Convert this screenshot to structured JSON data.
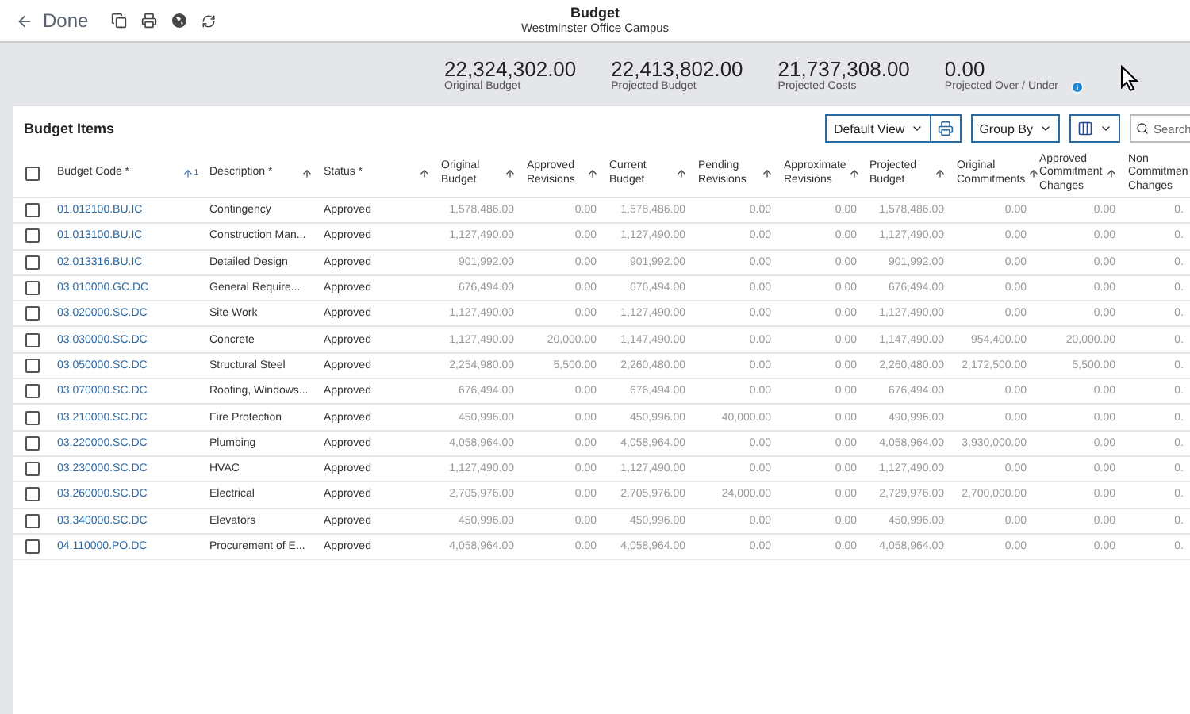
{
  "header": {
    "back_label": "Done",
    "title": "Budget",
    "subtitle": "Westminster Office Campus"
  },
  "summary": [
    {
      "value": "22,324,302.00",
      "label": "Original Budget"
    },
    {
      "value": "22,413,802.00",
      "label": "Projected Budget"
    },
    {
      "value": "21,737,308.00",
      "label": "Projected Costs"
    },
    {
      "value": "0.00",
      "label": "Projected Over / Under",
      "info": true
    }
  ],
  "panel": {
    "title": "Budget Items",
    "view_select": "Default View",
    "group_by": "Group By",
    "search": {
      "placeholder": "Search"
    }
  },
  "table": {
    "select_all": {
      "checked": false
    },
    "columns": [
      {
        "label": "Budget Code *",
        "sort_index": "1"
      },
      {
        "label": "Description *"
      },
      {
        "label": "Status *"
      },
      {
        "label": "Original Budget"
      },
      {
        "label": "Approved Revisions"
      },
      {
        "label": "Current Budget"
      },
      {
        "label": "Pending Revisions"
      },
      {
        "label": "Approximate Revisions"
      },
      {
        "label": "Projected Budget"
      },
      {
        "label": "Original Commitments"
      },
      {
        "label": "Approved Commitment Changes"
      },
      {
        "label": "Non Commitmen Changes"
      }
    ],
    "rows": [
      {
        "checked": false,
        "cells": [
          "01.012100.BU.IC",
          "Contingency",
          "Approved",
          "1,578,486.00",
          "0.00",
          "1,578,486.00",
          "0.00",
          "0.00",
          "1,578,486.00",
          "0.00",
          "0.00",
          "0."
        ]
      },
      {
        "checked": false,
        "cells": [
          "01.013100.BU.IC",
          "Construction Man...",
          "Approved",
          "1,127,490.00",
          "0.00",
          "1,127,490.00",
          "0.00",
          "0.00",
          "1,127,490.00",
          "0.00",
          "0.00",
          "0."
        ]
      },
      {
        "checked": false,
        "cells": [
          "02.013316.BU.IC",
          "Detailed Design",
          "Approved",
          "901,992.00",
          "0.00",
          "901,992.00",
          "0.00",
          "0.00",
          "901,992.00",
          "0.00",
          "0.00",
          "0."
        ]
      },
      {
        "checked": false,
        "cells": [
          "03.010000.GC.DC",
          "General Require...",
          "Approved",
          "676,494.00",
          "0.00",
          "676,494.00",
          "0.00",
          "0.00",
          "676,494.00",
          "0.00",
          "0.00",
          "0."
        ]
      },
      {
        "checked": false,
        "cells": [
          "03.020000.SC.DC",
          "Site Work",
          "Approved",
          "1,127,490.00",
          "0.00",
          "1,127,490.00",
          "0.00",
          "0.00",
          "1,127,490.00",
          "0.00",
          "0.00",
          "0."
        ]
      },
      {
        "checked": false,
        "cells": [
          "03.030000.SC.DC",
          "Concrete",
          "Approved",
          "1,127,490.00",
          "20,000.00",
          "1,147,490.00",
          "0.00",
          "0.00",
          "1,147,490.00",
          "954,400.00",
          "20,000.00",
          "0."
        ]
      },
      {
        "checked": false,
        "cells": [
          "03.050000.SC.DC",
          "Structural Steel",
          "Approved",
          "2,254,980.00",
          "5,500.00",
          "2,260,480.00",
          "0.00",
          "0.00",
          "2,260,480.00",
          "2,172,500.00",
          "5,500.00",
          "0."
        ]
      },
      {
        "checked": false,
        "cells": [
          "03.070000.SC.DC",
          "Roofing, Windows...",
          "Approved",
          "676,494.00",
          "0.00",
          "676,494.00",
          "0.00",
          "0.00",
          "676,494.00",
          "0.00",
          "0.00",
          "0."
        ]
      },
      {
        "checked": false,
        "cells": [
          "03.210000.SC.DC",
          "Fire Protection",
          "Approved",
          "450,996.00",
          "0.00",
          "450,996.00",
          "40,000.00",
          "0.00",
          "490,996.00",
          "0.00",
          "0.00",
          "0."
        ]
      },
      {
        "checked": false,
        "cells": [
          "03.220000.SC.DC",
          "Plumbing",
          "Approved",
          "4,058,964.00",
          "0.00",
          "4,058,964.00",
          "0.00",
          "0.00",
          "4,058,964.00",
          "3,930,000.00",
          "0.00",
          "0."
        ]
      },
      {
        "checked": false,
        "cells": [
          "03.230000.SC.DC",
          "HVAC",
          "Approved",
          "1,127,490.00",
          "0.00",
          "1,127,490.00",
          "0.00",
          "0.00",
          "1,127,490.00",
          "0.00",
          "0.00",
          "0."
        ]
      },
      {
        "checked": false,
        "cells": [
          "03.260000.SC.DC",
          "Electrical",
          "Approved",
          "2,705,976.00",
          "0.00",
          "2,705,976.00",
          "24,000.00",
          "0.00",
          "2,729,976.00",
          "2,700,000.00",
          "0.00",
          "0."
        ]
      },
      {
        "checked": false,
        "cells": [
          "03.340000.SC.DC",
          "Elevators",
          "Approved",
          "450,996.00",
          "0.00",
          "450,996.00",
          "0.00",
          "0.00",
          "450,996.00",
          "0.00",
          "0.00",
          "0."
        ]
      },
      {
        "checked": false,
        "cells": [
          "04.110000.PO.DC",
          "Procurement of E...",
          "Approved",
          "4,058,964.00",
          "0.00",
          "4,058,964.00",
          "0.00",
          "0.00",
          "4,058,964.00",
          "0.00",
          "0.00",
          "0."
        ]
      }
    ]
  }
}
